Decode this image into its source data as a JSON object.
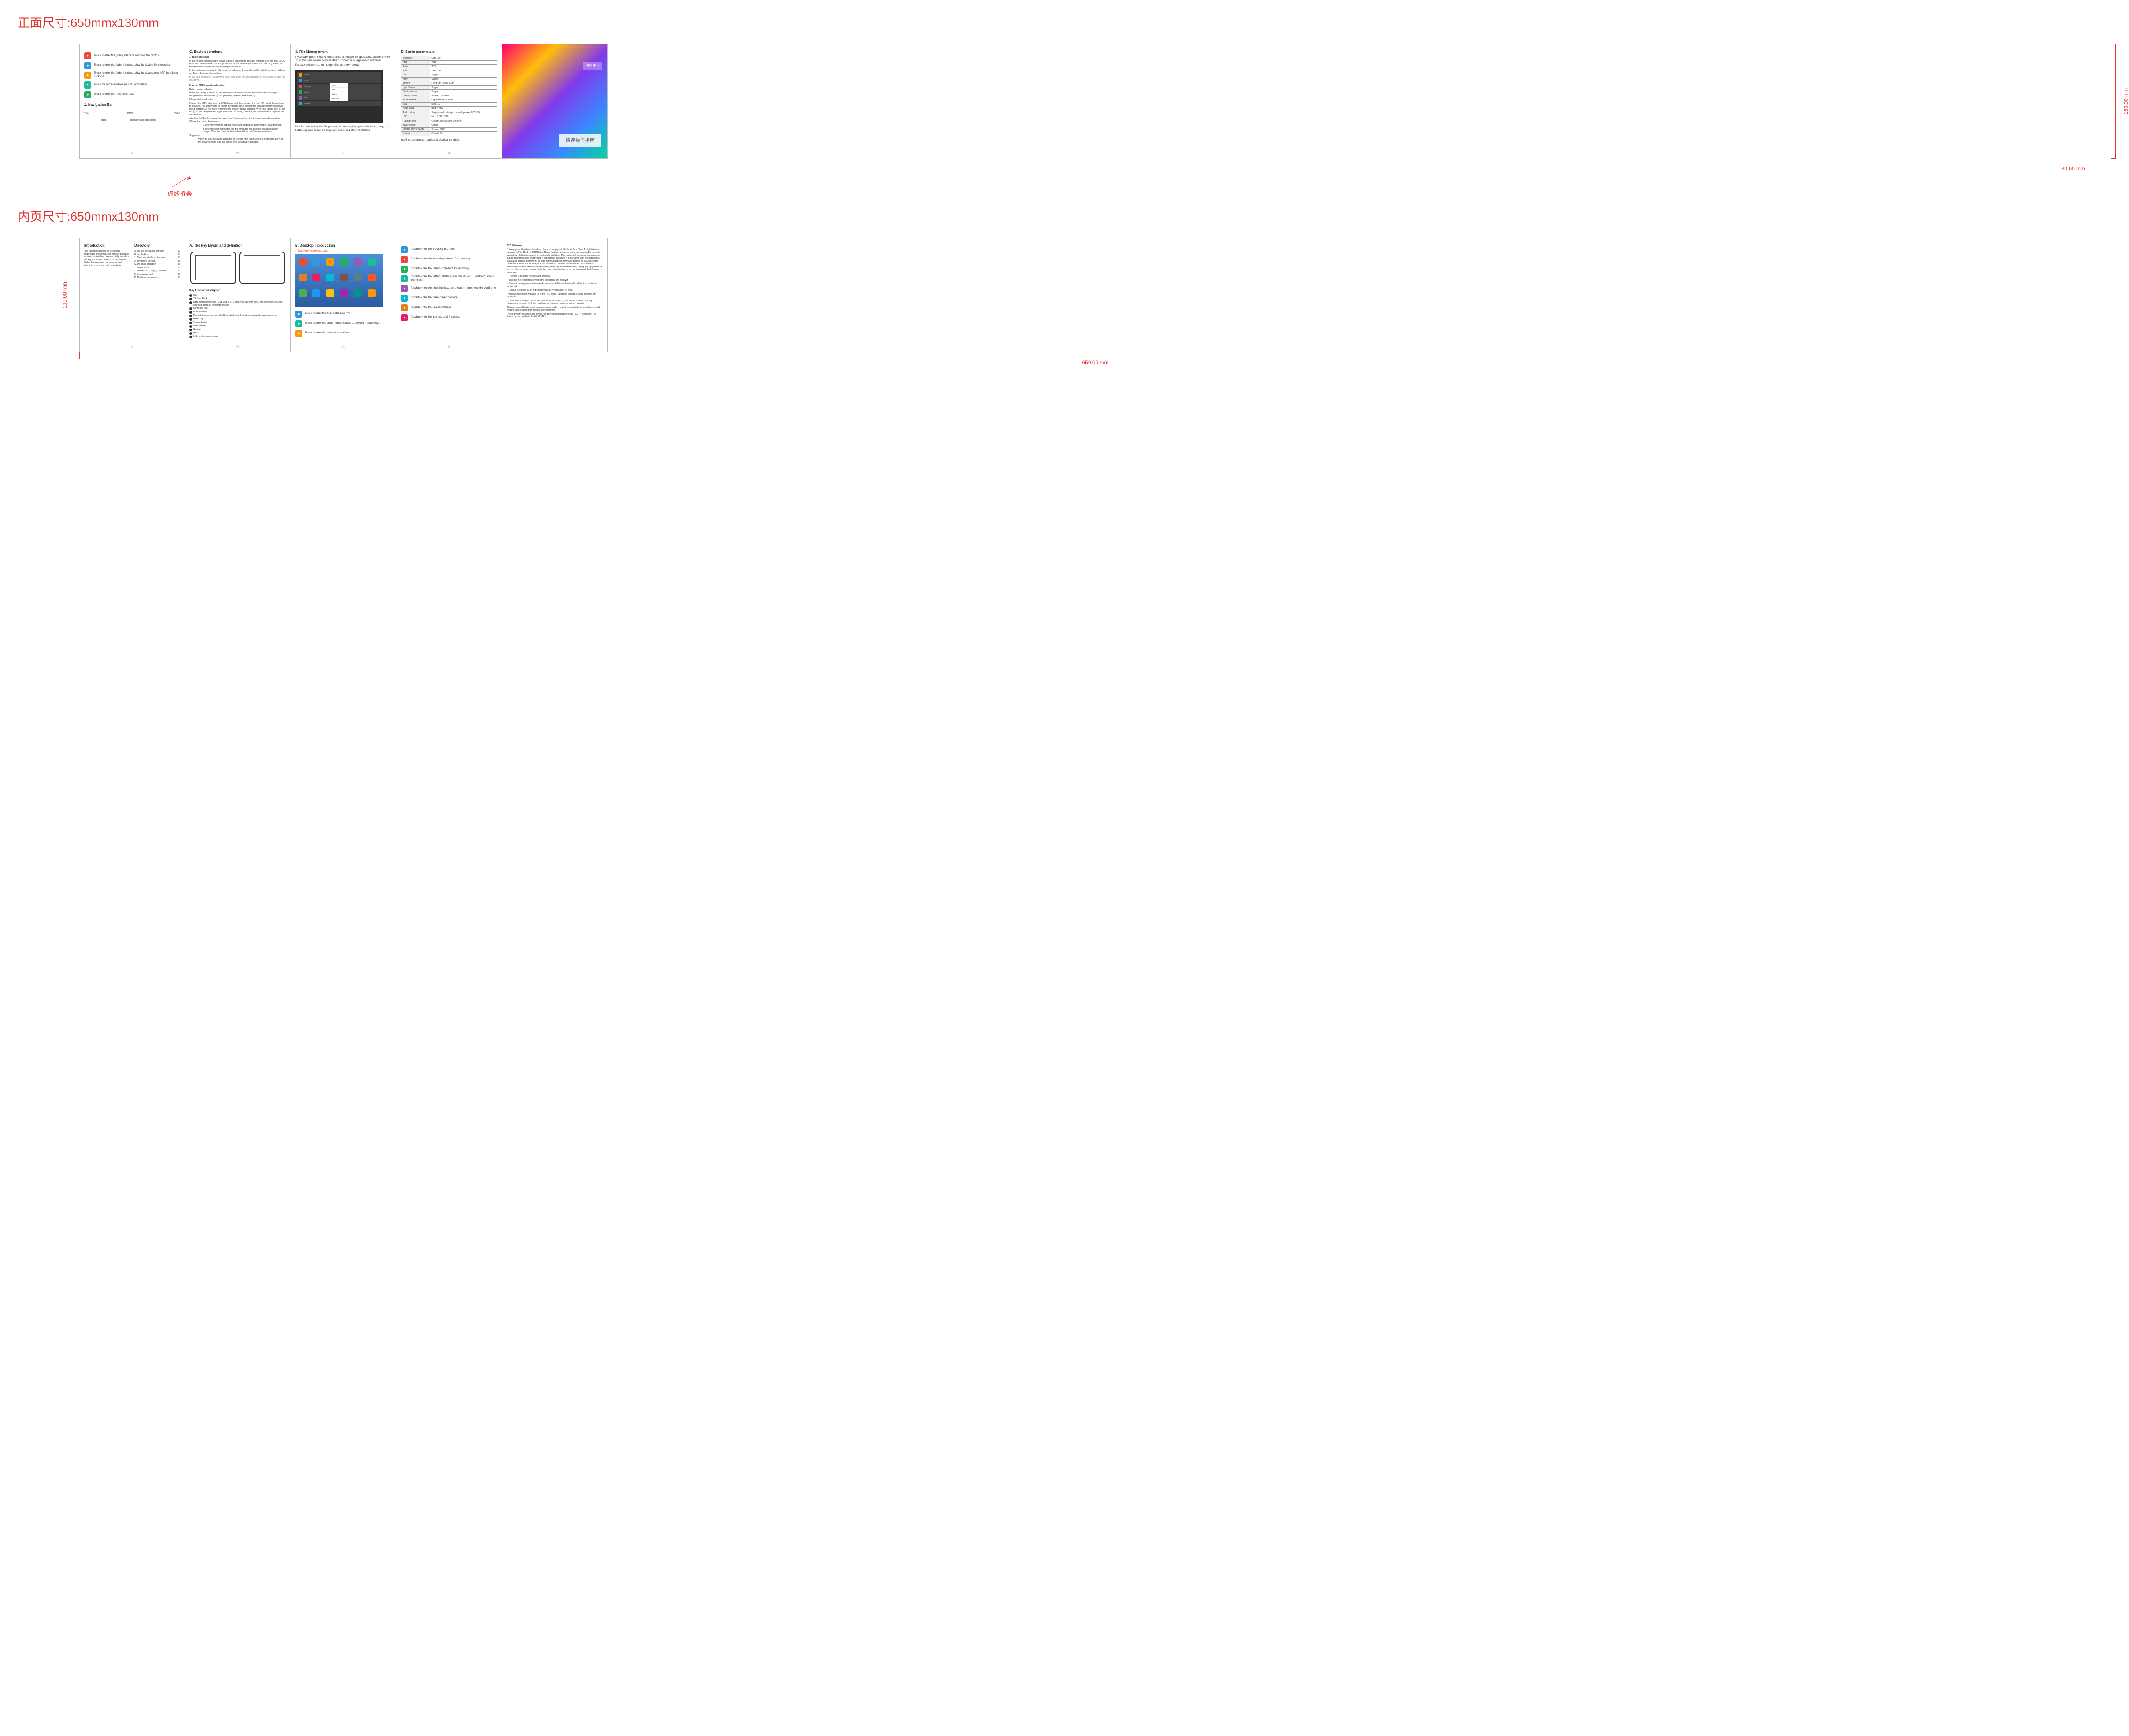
{
  "titles": {
    "front": "正面尺寸:650mmx130mm",
    "inner": "内页尺寸:650mmx130mm"
  },
  "fold": "虚线折叠",
  "dims": {
    "h": "130.00 mm",
    "w": "650.00 mm",
    "wp": "130.00 mm"
  },
  "cover": {
    "title": "快速操作指南",
    "btn": "开始使用"
  },
  "front": {
    "p1": {
      "rows": [
        {
          "ic": "i-red",
          "t": "Touch to enter the gallery interface and view the photos."
        },
        {
          "ic": "i-blue",
          "t": "Touch to enter the folder interface, view the device file information."
        },
        {
          "ic": "i-yel",
          "t": "Touch to enter the folder interface, view the downloaded APP installation package."
        },
        {
          "ic": "i-teal",
          "t": "Touch the camera to take pictures and videos."
        },
        {
          "ic": "i-grn",
          "t": "Touch to enter the music interface."
        }
      ],
      "nav": {
        "title": "2. Navigation Bar",
        "l1": "VOL-",
        "l2": "Back",
        "l3": "Home",
        "l4": "Recently used application",
        "l5": "VOL+"
      },
      "pg": "05"
    },
    "p2": {
      "title": "C. Basic operations",
      "s1": {
        "h": "1. boot / shutdown",
        "t1": "In the off state, long press the power button (3 seconds) to boot, the machine after the boot LOGO, enter the main interface. It is also possible to insert the charger when it is turned on (please use the standard charger), and the power light will turn on.",
        "t2": "In the boot state, press and hold the power button for 3 seconds, and the shutdown option will pop up. Touch Shutdown to shutdown.",
        "t3": "In the case of crash or replacement touch, long press the power button for 10 seconds to force the shutdown."
      },
      "s2": {
        "h": "2. power / USB charging detection",
        "t1": "Battery usage indicator:",
        "t2": "When the battery is in use, as the battery power decreases, the white bar on the desktop's navigation bar battery icon 🔋 will gradually decrease to the icon 🔋.",
        "t3": "Charge status indication:",
        "t4": "Connect the USB cable with the USB charger and then connect it to the USB port of the machine to charge it. The battery icon 🔋 on the navigation bar of the desktop indicates that the battery is being charged. Do not insert or remove the charger during charging. When the battery icon 🔋 fills up 🔋 on the navigation bar application shortcut setting interface, the battery level is displayed as \"low-mid-full\".",
        "t5": "attention: 1. After the machine is powered off, do not perform the firmware upgrade operation. Charge the battery beforehand.",
        "t6": "2. When the machine is powered off and plugged in, there will be a charging icon.",
        "t7": "3. When the USB is plugged into the computer, the machine will automatically charge. When the power of the machine is low, don't do any operations.",
        "t8": "Suggestion:",
        "t9": "When the user uses and upgrades for the first time, the machine is charged to 100% of the power to make sure the battery level is relatively accurate."
      },
      "pg": "06"
    },
    "p3": {
      "title": "3. File Management",
      "t1": "If you copy, paste, move or delete a file or multiple file operations, click on the icon 📁 in the main screen to access the \"Explorer\" in all application interfaces.",
      "t2": "For example, operate on multiple files as shown below.",
      "fm": [
        {
          "c": "#f39c12",
          "n": "Alarms"
        },
        {
          "c": "#3498db",
          "n": "DCIM"
        },
        {
          "c": "#e74c3c",
          "n": "Download"
        },
        {
          "c": "#27ae60",
          "n": "Movies"
        },
        {
          "c": "#9b59b6",
          "n": "Music"
        },
        {
          "c": "#1abc9c",
          "n": "Pictures"
        }
      ],
      "ctx": [
        "Copy",
        "Cut",
        "Delete",
        "Rename"
      ],
      "t3": "First find the path of the file you want to operate, long press the folder, copy, cut button appears above the copy, cut, delete and other operations.",
      "pg": "07"
    },
    "p4": {
      "title": "D. Basic parameters",
      "specs": [
        [
          "processor",
          "Octa-Core"
        ],
        [
          "DDR",
          "2GB"
        ],
        [
          "Flash",
          "32G"
        ],
        [
          "WIFI",
          "2.4G / 5G"
        ],
        [
          "B-T",
          "Support"
        ],
        [
          "HDMI",
          "Support"
        ],
        [
          "camera",
          "Front: 2MP, Rear: 5MP"
        ],
        [
          "Light Sensor",
          "Support"
        ],
        [
          "Gravity Sensor",
          "Support"
        ],
        [
          "Display screen",
          "8.0inch 1280x800"
        ],
        [
          "Touch method",
          "Capacitive multi-touch"
        ],
        [
          "Battery",
          "5000mAh"
        ],
        [
          "Audio input",
          "Built-in MIC"
        ],
        [
          "Audio output",
          "Single-sided, Left/right channel speaker, 8Ω/1.0W"
        ],
        [
          "USB",
          "Micro-USB / OTG"
        ],
        [
          "Function keys",
          "On/Off/Reset/Volume+/Volume-"
        ],
        [
          "power supply",
          "Option"
        ],
        [
          "MICRO SD/TF CARD",
          "Support 64GB"
        ],
        [
          "system",
          "Android 7.1"
        ]
      ],
      "note": "※:",
      "note2": "All parameters are subject to physical condition.",
      "pg": "08"
    }
  },
  "inner": {
    "p1": {
      "title": "Introduction",
      "intro": "The operation guide is for the user to understand and familiarized with our products as soon as possible. Here we briefly introduce the key layout and definition of the machine, With a few examples, show some basic instructions on some basic operations.",
      "dir": "Directory",
      "items": [
        [
          "A. the key layout and definition",
          "02"
        ],
        [
          "B. the desktop",
          "03"
        ],
        [
          "1. The main interface introduced",
          "03"
        ],
        [
          "2. navigation bar icon",
          "05"
        ],
        [
          "C. the basic operation",
          "06"
        ],
        [
          "1. Power on/off",
          "06"
        ],
        [
          "2. Power/USB charging detection",
          "06"
        ],
        [
          "3. file management",
          "07"
        ],
        [
          "D. The basic parameters",
          "08"
        ]
      ],
      "pg": "01"
    },
    "p2": {
      "title": "A. The key layout and definition",
      "kt": "Key function description:",
      "keys": [
        "MIC",
        "TF Card Book",
        "USB charging interface / USB wual / OTG seat, USB line interface, OTG line interface, USB charging interface, keyboard, mouse",
        "Earphone seat",
        "Front camera",
        "Power button: press and hold 3S to switch on/off, short press again to wake up screen",
        "Reset key",
        "Volume button",
        "Rear camera",
        "Speaker",
        "HDMI",
        "Light environment sensor"
      ],
      "pg": "02"
    },
    "p3": {
      "title": "B. Desktop introduction",
      "sub": "1. Main interface introduction",
      "rows": [
        {
          "ic": "i-blue",
          "t": "Touch to enter the APK installation tool."
        },
        {
          "ic": "i-teal",
          "t": "Touch to enter the email menu interface to perform mailbox login."
        },
        {
          "ic": "i-yel",
          "t": "Touch to enter the calculator interface."
        }
      ],
      "pg": "03"
    },
    "p4": {
      "rows": [
        {
          "ic": "i-blue",
          "t": "Touch to enter the browsing interface."
        },
        {
          "ic": "i-red",
          "t": "Touch to enter the recording interface for recording."
        },
        {
          "ic": "i-grn",
          "t": "Touch to enter the calendar interface for recording."
        },
        {
          "ic": "i-teal",
          "t": "Touch to enter the setting interface, you can set WIFI, Bluetooth, screen brightness."
        },
        {
          "ic": "i-pur",
          "t": "Touch to enter the clock interface, set the alarm time, view the world time."
        },
        {
          "ic": "i-cyan",
          "t": "Touch to enter the video player interface."
        },
        {
          "ic": "i-org",
          "t": "Touch to enter the search interface."
        },
        {
          "ic": "i-pink",
          "t": "Touch to enter the address book interface."
        }
      ],
      "pg": "04"
    },
    "p5": {
      "title": "FCC Statement",
      "body": [
        "This equipment has been tested and found to comply with the limits for a Class B digital device, pursuant to Part 15 of the FCC Rules. These limits are designed to provide reasonable protection against harmful interference in a residential installation. This equipment generates uses and can radiate radio frequency energy and, if not installed and used in accordance with the instructions, may cause harmful interference to radio communications. However, there is no guarantee that interference will not occur in a particular installation. If this equipment does cause harmful interference to radio or television reception, which can be determined by turning the equipment off and on, the user is encouraged to try to correct the interference by one or more of the following measures:",
        "-- Reorient or relocate the receiving antenna.",
        "-- Increase the separation between the equipment and receiver.",
        "-- Connect the equipment into an outlet on a circuit different from that to which the receiver is connected.",
        "-- Consult the dealer or an experienced radio/TV technician for help.",
        "",
        "This device complies with part 15 of the FCC Rules. Operation is subject to the following two conditions:",
        "(1) This device may not cause harmful interference, and (2) this device must accept any interference received, including interference that may cause undesired operation.",
        "",
        "Changes or modifications not expressly approved by the party responsible for compliance could void the user's authority to operate the equipment.",
        "The body worn operation, the device has been tested and meets the FCC RF exposure. The device can be used with the 0 CM SARs."
      ]
    }
  }
}
